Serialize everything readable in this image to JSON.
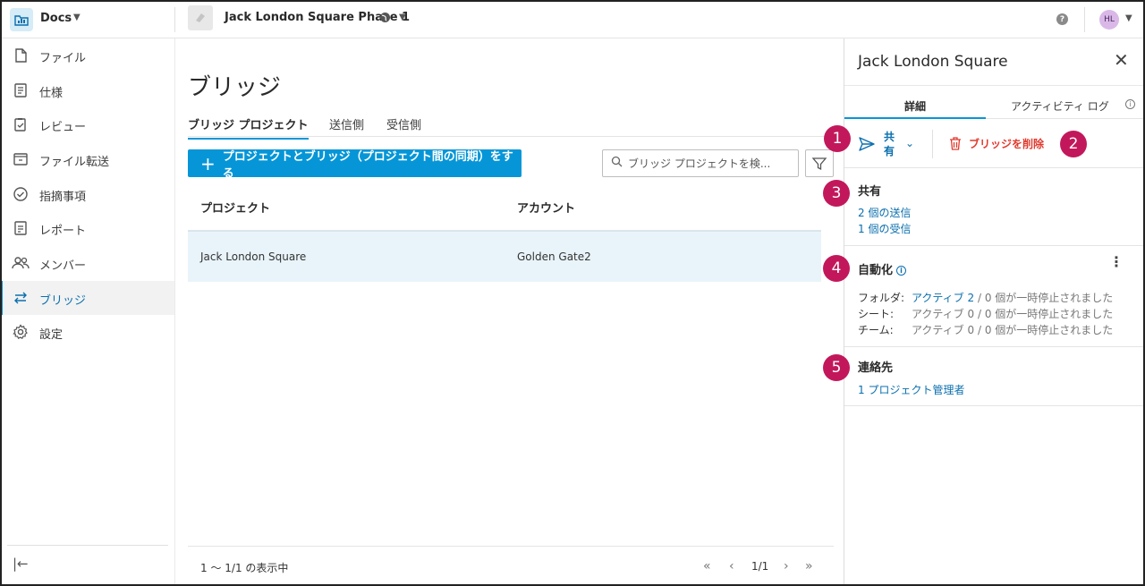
{
  "topbar": {
    "app_name": "Docs",
    "project_name": "Jack London Square Phase 1",
    "avatar_initials": "HL"
  },
  "sidebar": {
    "items": [
      {
        "label": "ファイル",
        "icon": "file-icon"
      },
      {
        "label": "仕様",
        "icon": "spec-icon"
      },
      {
        "label": "レビュー",
        "icon": "review-icon"
      },
      {
        "label": "ファイル転送",
        "icon": "transfer-icon"
      },
      {
        "label": "指摘事項",
        "icon": "issues-icon"
      },
      {
        "label": "レポート",
        "icon": "report-icon"
      },
      {
        "label": "メンバー",
        "icon": "members-icon"
      },
      {
        "label": "ブリッジ",
        "icon": "bridge-icon"
      },
      {
        "label": "設定",
        "icon": "settings-icon"
      }
    ],
    "active_index": 7
  },
  "main": {
    "title": "ブリッジ",
    "tabs": [
      {
        "label": "ブリッジ プロジェクト"
      },
      {
        "label": "送信側"
      },
      {
        "label": "受信側"
      }
    ],
    "primary_button": "プロジェクトとブリッジ（プロジェクト間の同期）をする",
    "search_placeholder": "ブリッジ プロジェクトを検...",
    "columns": [
      "プロジェクト",
      "アカウント"
    ],
    "rows": [
      {
        "project": "Jack London Square",
        "account": "Golden Gate2"
      }
    ],
    "footer": "1 〜 1/1 の表示中",
    "page": "1/1"
  },
  "panel": {
    "title": "Jack London Square",
    "tabs": [
      {
        "label": "詳細"
      },
      {
        "label": "アクティビティ ログ"
      }
    ],
    "share_label": "共有",
    "delete_label": "ブリッジを削除",
    "share_section": {
      "title": "共有",
      "sent": "2 個の送信",
      "received": "1 個の受信"
    },
    "automation": {
      "title": "自動化",
      "rows": [
        {
          "key": "フォルダ:",
          "active": "アクティブ 2",
          "paused": " / 0 個が一時停止されました",
          "on": true
        },
        {
          "key": "シート:",
          "active": "アクティブ 0",
          "paused": " / 0 個が一時停止されました",
          "on": false
        },
        {
          "key": "チーム:",
          "active": "アクティブ 0",
          "paused": " / 0 個が一時停止されました",
          "on": false
        }
      ]
    },
    "contacts": {
      "title": "連絡先",
      "admin": "1 プロジェクト管理者"
    }
  },
  "callouts": [
    "1",
    "2",
    "3",
    "4",
    "5"
  ],
  "colors": {
    "accent": "#0696d7",
    "link": "#0a6fae",
    "danger": "#e03a2d",
    "callout": "#c2185b",
    "row_selected": "#e9f4fa"
  }
}
